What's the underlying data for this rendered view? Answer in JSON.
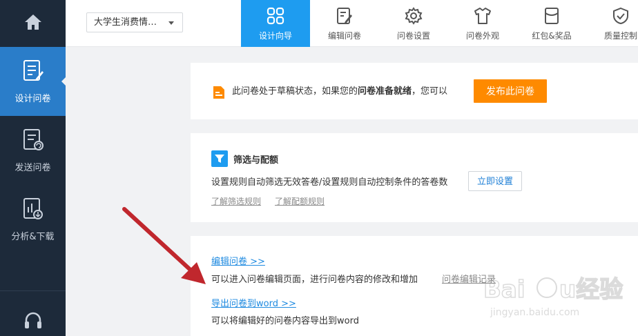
{
  "sidebar": {
    "home_icon": "home-icon",
    "items": [
      {
        "label": "设计问卷",
        "icon": "design-survey-icon",
        "active": true
      },
      {
        "label": "发送问卷",
        "icon": "send-survey-icon",
        "active": false
      },
      {
        "label": "分析&下载",
        "icon": "analysis-download-icon",
        "active": false
      }
    ],
    "support_icon": "headset-icon"
  },
  "topbar": {
    "survey_select_value": "大学生消费情…",
    "tabs": [
      {
        "label": "设计向导",
        "icon": "grid-icon",
        "active": true
      },
      {
        "label": "编辑问卷",
        "icon": "edit-icon",
        "active": false
      },
      {
        "label": "问卷设置",
        "icon": "gear-icon",
        "active": false
      },
      {
        "label": "问卷外观",
        "icon": "shirt-icon",
        "active": false
      },
      {
        "label": "红包&奖品",
        "icon": "red-envelope-icon",
        "active": false
      },
      {
        "label": "质量控制",
        "icon": "shield-icon",
        "active": false
      }
    ]
  },
  "draft_card": {
    "text_before": "此问卷处于草稿状态，如果您的",
    "text_bold": "问卷准备就绪",
    "text_after": "，您可以",
    "publish_label": "发布此问卷"
  },
  "filter_card": {
    "title": "筛选与配额",
    "desc": "设置规则自动筛选无效答卷/设置规则自动控制条件的答卷数",
    "setup_label": "立即设置",
    "link1": "了解筛选规则",
    "link2": "了解配额规则"
  },
  "edit_card": {
    "edit_link": "编辑问卷 >>",
    "edit_desc": "可以进入问卷编辑页面，进行问卷内容的修改和增加",
    "edit_record": "问卷编辑记录",
    "export_link": "导出问卷到word >>",
    "export_desc": "可以将编辑好的问卷内容导出到word"
  },
  "colors": {
    "sidebar_bg": "#1d2a3a",
    "active_blue": "#2a7dc9",
    "tab_blue": "#1e9cf0",
    "publish_orange": "#fe8a00",
    "arrow_red": "#c0272d"
  },
  "watermark": {
    "text": "Baidu经验",
    "sub": "jingyan.baidu.com"
  }
}
